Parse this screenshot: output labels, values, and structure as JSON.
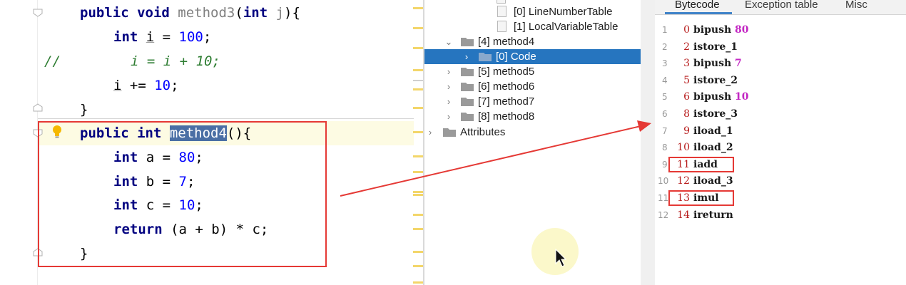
{
  "editor": {
    "lines": [
      {
        "kw": "public void ",
        "name": "method3",
        "open": "(",
        "type": "int",
        "param": " j",
        "close": "){"
      },
      {
        "kw": "int ",
        "var": "i",
        "rest": " = ",
        "num": "100",
        "end": ";"
      },
      {
        "prefix": "//",
        "text": "i = i + 10;"
      },
      {
        "var": "i",
        "rest": " += ",
        "num": "10",
        "end": ";"
      },
      {
        "text": "}"
      },
      {
        "kw": "public int ",
        "name": "method4",
        "rest": "(){"
      },
      {
        "kw": "int ",
        "rest": "a = ",
        "num": "80",
        "end": ";"
      },
      {
        "kw": "int ",
        "rest": "b = ",
        "num": "7",
        "end": ";"
      },
      {
        "kw": "int ",
        "rest": "c = ",
        "num": "10",
        "end": ";"
      },
      {
        "kw": "return ",
        "rest": "(a + b) * c;"
      },
      {
        "text": "}"
      }
    ]
  },
  "tree": {
    "rows": [
      {
        "label": "[0] LineNumberTable",
        "type": "file"
      },
      {
        "label": "[1] LocalVariableTable",
        "type": "file"
      },
      {
        "label": "[4] method4",
        "type": "folder",
        "expanded": true
      },
      {
        "label": "[0] Code",
        "type": "folder",
        "selected": true
      },
      {
        "label": "[5] method5",
        "type": "folder"
      },
      {
        "label": "[6] method6",
        "type": "folder"
      },
      {
        "label": "[7] method7",
        "type": "folder"
      },
      {
        "label": "[8] method8",
        "type": "folder"
      },
      {
        "label": "Attributes",
        "type": "folder"
      }
    ]
  },
  "bytecode": {
    "tabs": [
      "Bytecode",
      "Exception table",
      "Misc"
    ],
    "active_tab": "Bytecode",
    "lines": [
      {
        "ln": "1",
        "offset": "0",
        "op": "bipush",
        "arg": "80"
      },
      {
        "ln": "2",
        "offset": "2",
        "op": "istore_1",
        "arg": ""
      },
      {
        "ln": "3",
        "offset": "3",
        "op": "bipush",
        "arg": "7"
      },
      {
        "ln": "4",
        "offset": "5",
        "op": "istore_2",
        "arg": ""
      },
      {
        "ln": "5",
        "offset": "6",
        "op": "bipush",
        "arg": "10"
      },
      {
        "ln": "6",
        "offset": "8",
        "op": "istore_3",
        "arg": ""
      },
      {
        "ln": "7",
        "offset": "9",
        "op": "iload_1",
        "arg": ""
      },
      {
        "ln": "8",
        "offset": "10",
        "op": "iload_2",
        "arg": ""
      },
      {
        "ln": "9",
        "offset": "11",
        "op": "iadd",
        "arg": ""
      },
      {
        "ln": "10",
        "offset": "12",
        "op": "iload_3",
        "arg": ""
      },
      {
        "ln": "11",
        "offset": "13",
        "op": "imul",
        "arg": ""
      },
      {
        "ln": "12",
        "offset": "14",
        "op": "ireturn",
        "arg": ""
      }
    ]
  },
  "colors": {
    "annotation": "#e53935",
    "selection": "#2675bf",
    "keyword": "#000080",
    "number": "#0000ff"
  }
}
